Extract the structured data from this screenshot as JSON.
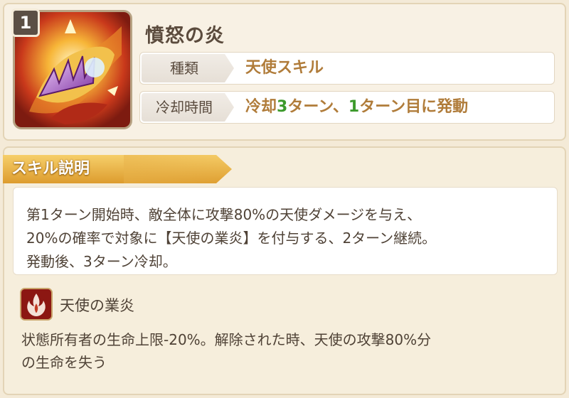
{
  "skill": {
    "level": "1",
    "name": "憤怒の炎",
    "icon": "flaming-fist-icon",
    "type_label": "種類",
    "type_value": "天使スキル",
    "cooldown_label": "冷却時間",
    "cooldown_value": {
      "p1": "冷却",
      "n1": "3",
      "p2": "ターン、",
      "n2": "1",
      "p3": "ターン目に発動"
    }
  },
  "description": {
    "section_title": "スキル説明",
    "lines": [
      "第1ターン開始時、敵全体に攻撃80%の天使ダメージを与え、",
      "20%の確率で対象に【天使の業炎】を付与する、2ターン継続。",
      "発動後、3ターン冷却。"
    ]
  },
  "effect": {
    "icon": "flame-status-icon",
    "name": "天使の業炎",
    "lines": [
      "状態所有者の生命上限-20%。解除された時、天使の攻撃80%分",
      "の生命を失う"
    ]
  },
  "colors": {
    "value_text": "#b07c3a",
    "number_highlight": "#3d9a2c",
    "ribbon_gold": "#e8b24a",
    "background": "#f4ead7"
  }
}
